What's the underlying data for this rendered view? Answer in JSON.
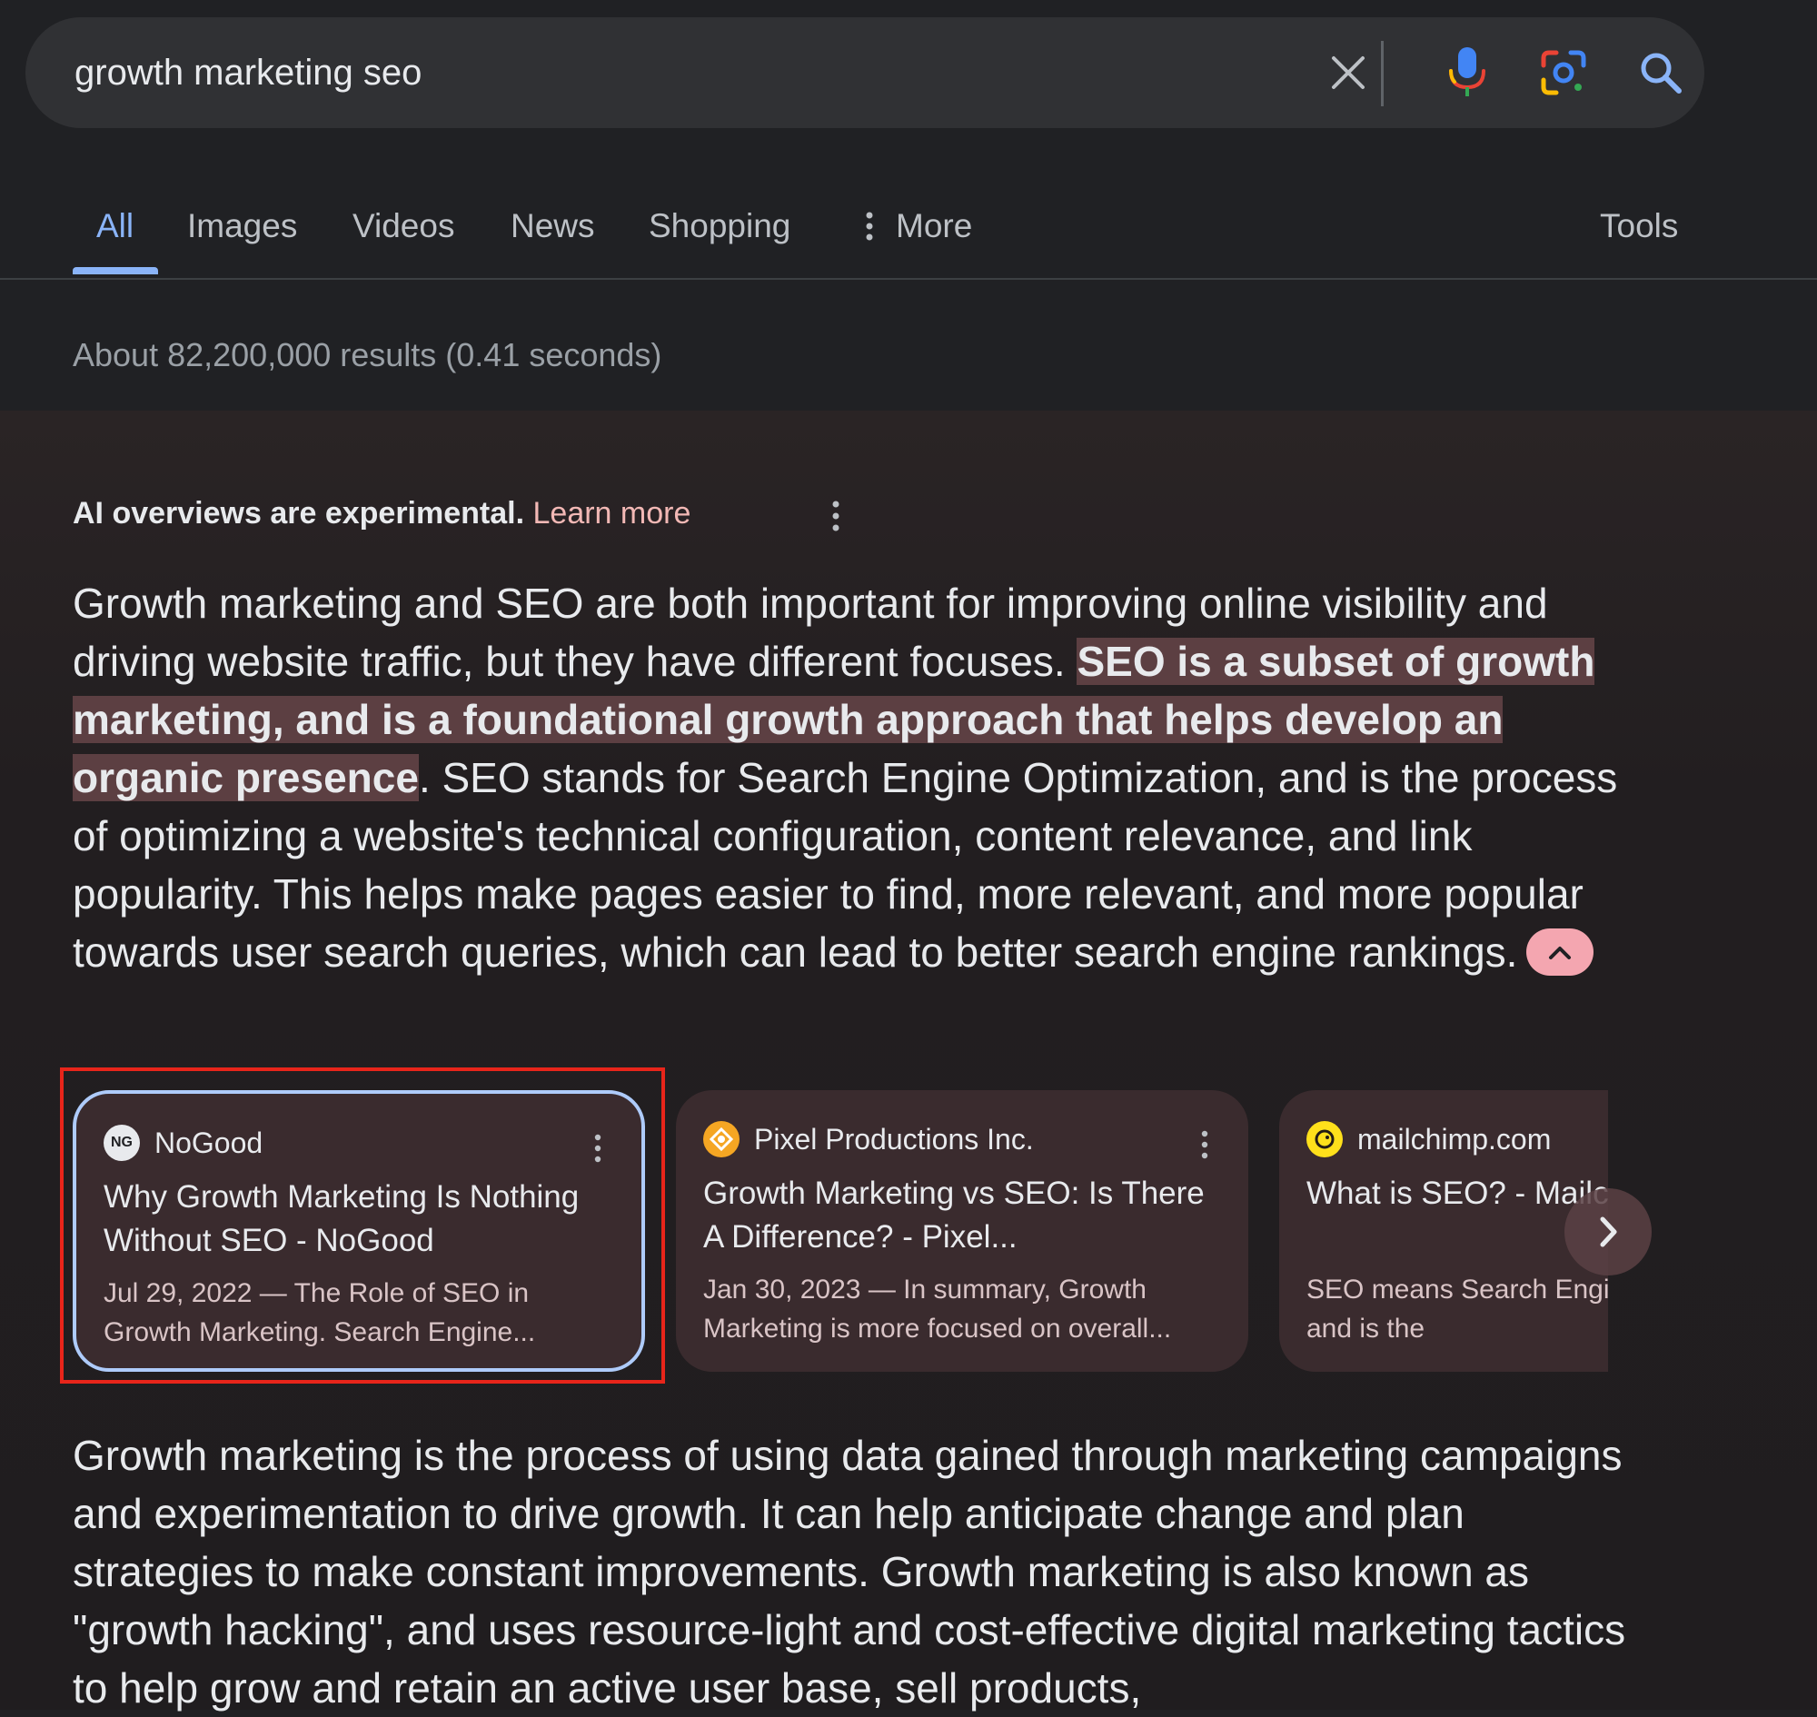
{
  "search": {
    "query": "growth marketing seo"
  },
  "tabs": [
    {
      "label": "All",
      "active": true
    },
    {
      "label": "Images"
    },
    {
      "label": "Videos"
    },
    {
      "label": "News"
    },
    {
      "label": "Shopping"
    },
    {
      "label": "More"
    },
    {
      "label": "Tools"
    }
  ],
  "result_stats": "About 82,200,000 results (0.41 seconds)",
  "ai_overview": {
    "notice": "AI overviews are experimental.",
    "learn_more": "Learn more",
    "paragraph1": {
      "part1": "Growth marketing and SEO are both important for improving online visibility and driving website traffic, but they have different focuses. ",
      "highlight": "SEO is a subset of growth marketing, and is a foundational growth approach that helps develop an organic presence",
      "part2": ". SEO stands for Search Engine Optimization, and is the process of optimizing a website's technical configuration, content relevance, and link popularity. This helps make pages easier to find, more relevant, and more popular towards user search queries, which can lead to better search engine rankings."
    },
    "paragraph2": "Growth marketing is the process of using data gained through marketing campaigns and experimentation to drive growth. It can help anticipate change and plan strategies to make constant improvements. Growth marketing is also known as \"growth hacking\", and uses resource-light and cost-effective digital marketing tactics to help grow and retain an active user base, sell products,"
  },
  "cards": [
    {
      "source": "NoGood",
      "favicon_text": "NG",
      "title": "Why Growth Marketing Is Nothing Without SEO - NoGood",
      "snippet": "Jul 29, 2022 — The Role of SEO in Growth Marketing. Search Engine...",
      "selected": true
    },
    {
      "source": "Pixel Productions Inc.",
      "title": "Growth Marketing vs SEO: Is There A Difference? - Pixel...",
      "snippet": "Jan 30, 2023 — In summary, Growth Marketing is more focused on overall..."
    },
    {
      "source": "mailchimp.com",
      "title": "What is SEO? - Mailchimp",
      "snippet": "SEO means Search Engine Optimization and is the"
    }
  ],
  "colors": {
    "accent": "#8ab4f8",
    "highlight_bg": "#5c3f42",
    "card_bg": "#3a2b2e",
    "selection": "#e8251a",
    "collapse_btn": "#f4a6b0"
  },
  "icons": {
    "clear": "close-icon",
    "voice": "microphone-icon",
    "lens": "google-lens-icon",
    "search": "search-icon",
    "more": "more-vert-icon",
    "collapse": "chevron-up-icon",
    "next": "chevron-right-icon"
  }
}
